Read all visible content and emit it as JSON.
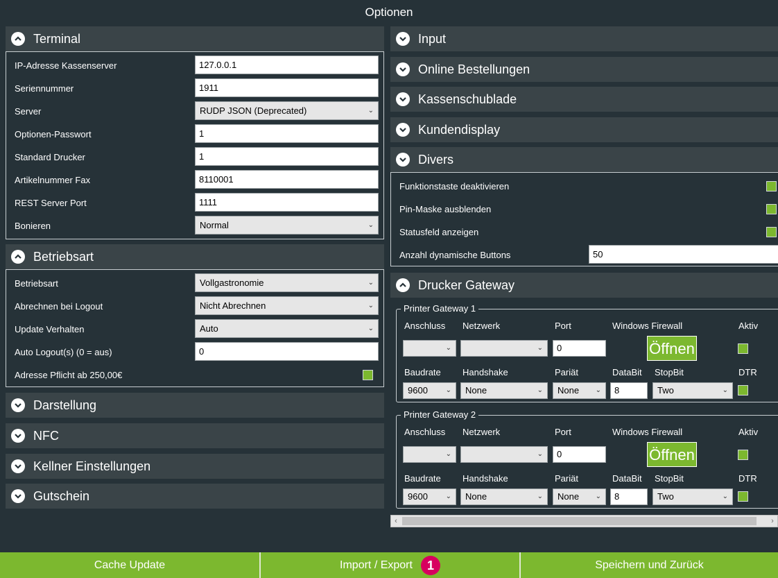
{
  "window": {
    "title": "Optionen"
  },
  "icons": {
    "collapse": "chevron-up-icon",
    "expand": "chevron-down-icon",
    "combo_arrow": "dropdown-arrow-icon"
  },
  "colors": {
    "accent": "#7cb82f",
    "background": "#263238",
    "header": "#3a4448",
    "badge": "#d7005f"
  },
  "left": {
    "terminal": {
      "title": "Terminal",
      "rows": [
        {
          "label": "IP-Adresse Kassenserver",
          "value": "127.0.0.1"
        },
        {
          "label": "Seriennummer",
          "value": "1911"
        },
        {
          "label": "Server",
          "value": "RUDP JSON (Deprecated)"
        },
        {
          "label": "Optionen-Passwort",
          "value": "1"
        },
        {
          "label": "Standard Drucker",
          "value": "1"
        },
        {
          "label": "Artikelnummer Fax",
          "value": "8110001"
        },
        {
          "label": "REST Server Port",
          "value": "1111"
        },
        {
          "label": "Bonieren",
          "value": "Normal"
        }
      ]
    },
    "betriebsart": {
      "title": "Betriebsart",
      "rows": [
        {
          "label": "Betriebsart",
          "value": "Vollgastronomie"
        },
        {
          "label": "Abrechnen bei Logout",
          "value": "Nicht Abrechnen"
        },
        {
          "label": "Update Verhalten",
          "value": "Auto"
        },
        {
          "label": "Auto Logout(s) (0 = aus)",
          "value": "0"
        },
        {
          "label": "Adresse Pflicht ab 250,00€",
          "checked": true
        }
      ]
    },
    "darstellung": {
      "title": "Darstellung"
    },
    "nfc": {
      "title": "NFC"
    },
    "kellner": {
      "title": "Kellner Einstellungen"
    },
    "gutschein": {
      "title": "Gutschein"
    }
  },
  "right": {
    "input": {
      "title": "Input"
    },
    "online": {
      "title": "Online Bestellungen"
    },
    "kassenschublade": {
      "title": "Kassenschublade"
    },
    "kundendisplay": {
      "title": "Kundendisplay"
    },
    "divers": {
      "title": "Divers",
      "rows": [
        {
          "label": "Funktionstaste deaktivieren",
          "checked": true
        },
        {
          "label": "Pin-Maske ausblenden",
          "checked": true
        },
        {
          "label": "Statusfeld anzeigen",
          "checked": true
        },
        {
          "label": "Anzahl dynamische Buttons",
          "value": "50"
        }
      ]
    },
    "gateway": {
      "title": "Drucker Gateway",
      "columns": {
        "anschluss": "Anschluss",
        "netzwerk": "Netzwerk",
        "port": "Port",
        "firewall": "Windows Firewall",
        "aktiv": "Aktiv",
        "baudrate": "Baudrate",
        "handshake": "Handshake",
        "paritaet": "Pariät",
        "databit": "DataBit",
        "stopbit": "StopBit",
        "dtr": "DTR"
      },
      "printers": [
        {
          "name": "Printer Gateway 1",
          "anschluss": "",
          "netzwerk": "",
          "port": "0",
          "open_label": "Öffnen",
          "aktiv": true,
          "baudrate": "9600",
          "handshake": "None",
          "paritaet": "None",
          "databit": "8",
          "stopbit": "Two",
          "dtr": true
        },
        {
          "name": "Printer Gateway 2",
          "anschluss": "",
          "netzwerk": "",
          "port": "0",
          "open_label": "Öffnen",
          "aktiv": true,
          "baudrate": "9600",
          "handshake": "None",
          "paritaet": "None",
          "databit": "8",
          "stopbit": "Two",
          "dtr": true
        }
      ]
    }
  },
  "footer": {
    "cache_update": "Cache Update",
    "import_export": "Import / Export",
    "import_badge": "1",
    "save_back": "Speichern und Zurück"
  }
}
